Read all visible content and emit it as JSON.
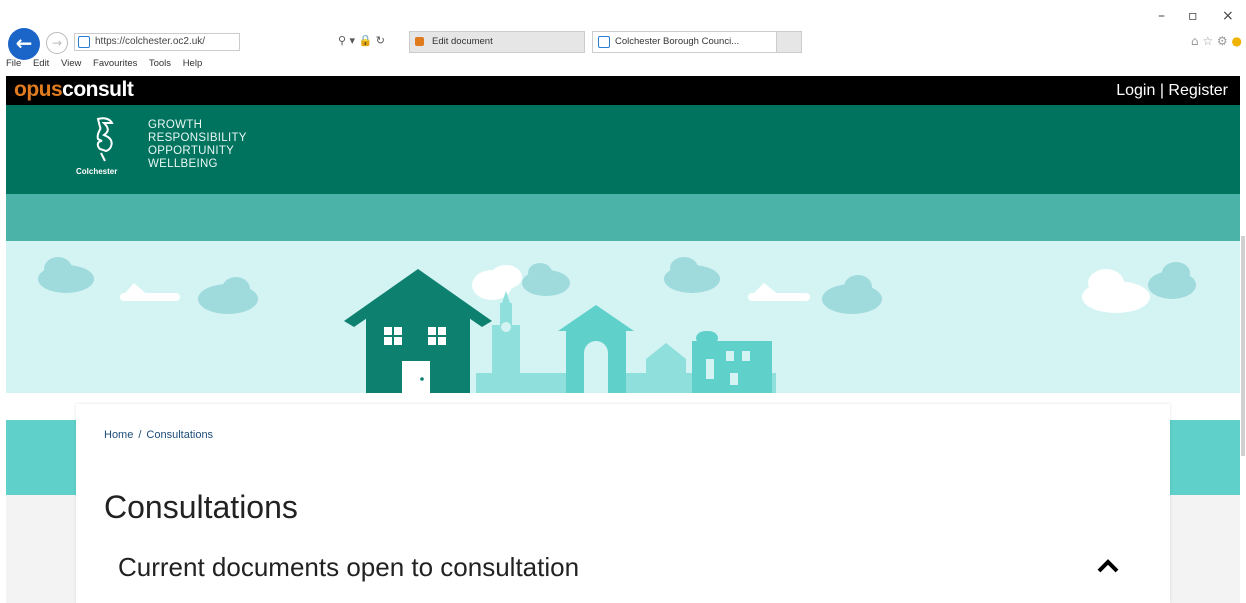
{
  "browser": {
    "address": "https://colchester.oc2.uk/",
    "tabs": [
      {
        "label": "Edit document",
        "active": false
      },
      {
        "label": "Colchester Borough Counci...",
        "active": true
      }
    ],
    "menu": [
      "File",
      "Edit",
      "View",
      "Favourites",
      "Tools",
      "Help"
    ],
    "controls": {
      "minimize": "–",
      "restore": "▫",
      "close": "×"
    }
  },
  "site": {
    "logo_part1": "opus",
    "logo_part2": "consult",
    "login": "Login",
    "divider": "|",
    "register": "Register",
    "council_name": "Colchester",
    "motto": [
      "GROWTH",
      "RESPONSIBILITY",
      "OPPORTUNITY",
      "WELLBEING"
    ],
    "colors": {
      "header": "#00735f",
      "subnav": "#4bb3a7",
      "hero": "#d4f3f3",
      "accent": "#e07b1e"
    }
  },
  "breadcrumb": {
    "home": "Home",
    "separator": "/",
    "current": "Consultations"
  },
  "page": {
    "title": "Consultations",
    "section_title": "Current documents open to consultation"
  }
}
